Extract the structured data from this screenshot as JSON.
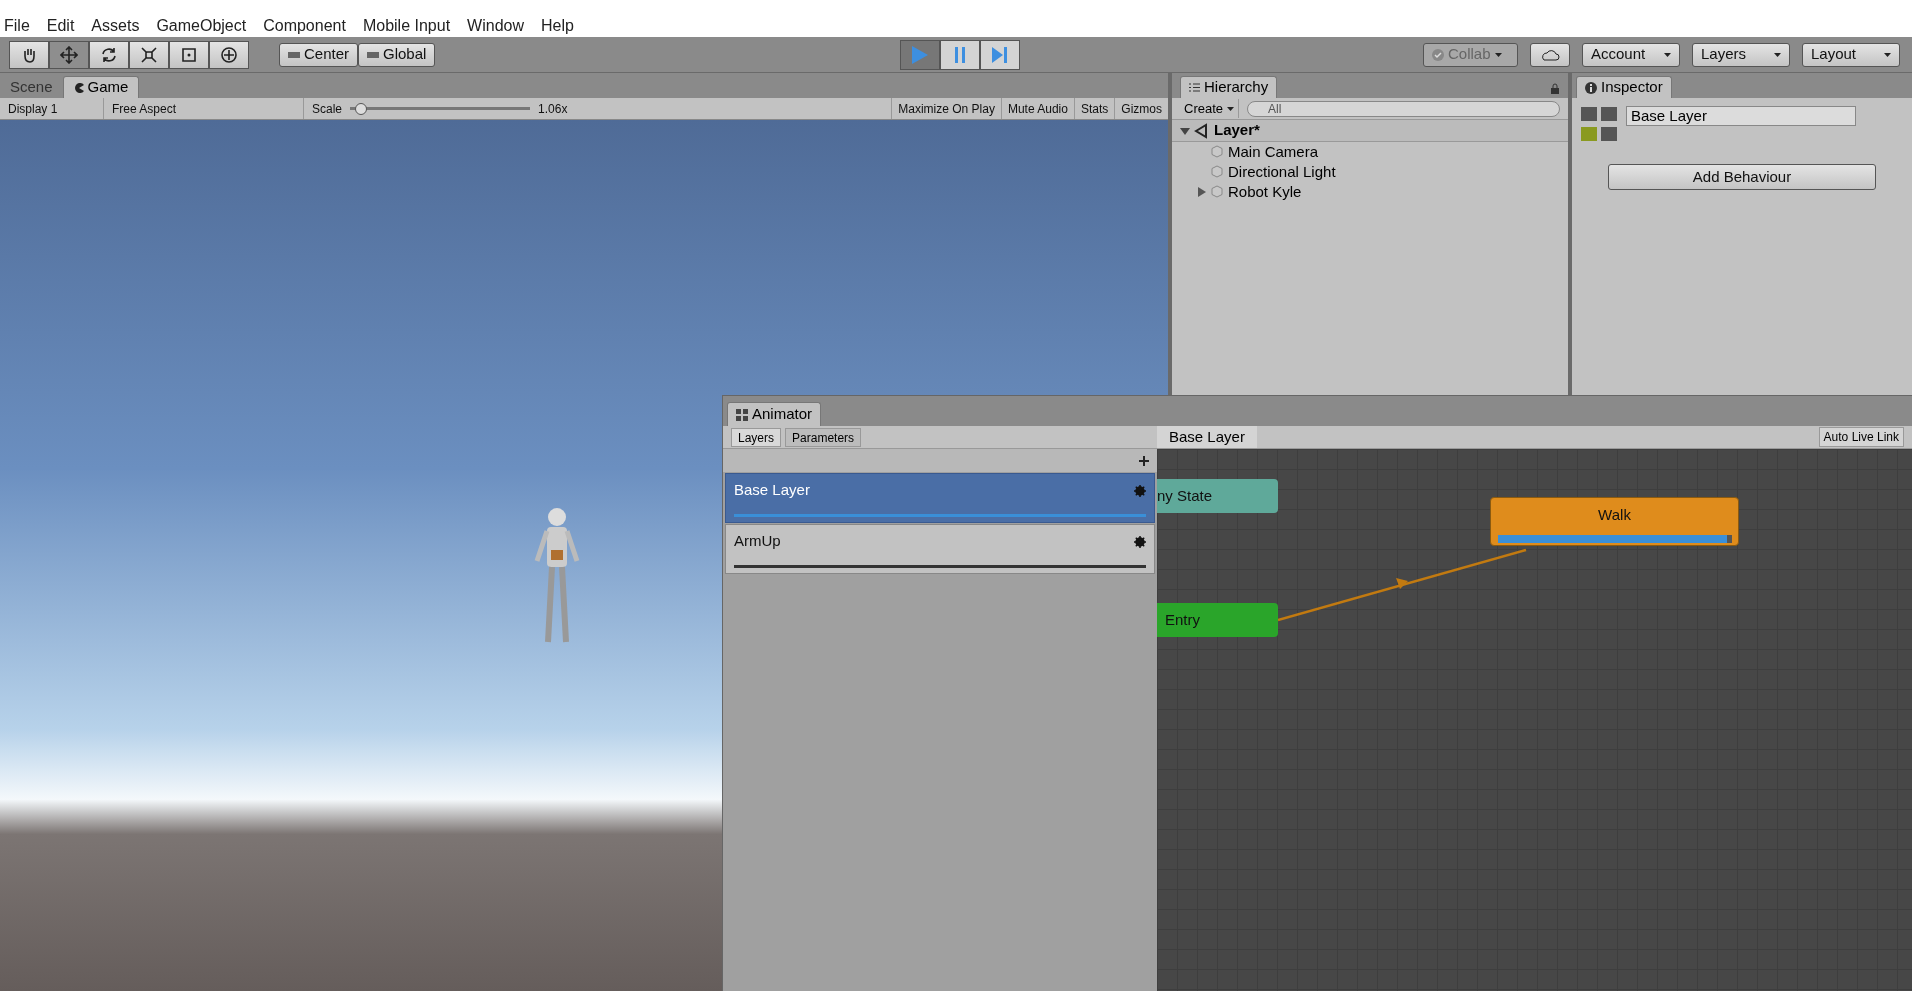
{
  "menu": [
    "File",
    "Edit",
    "Assets",
    "GameObject",
    "Component",
    "Mobile Input",
    "Window",
    "Help"
  ],
  "tools": [
    {
      "kind": "hand",
      "selected": false
    },
    {
      "kind": "move",
      "selected": true
    },
    {
      "kind": "rotate",
      "selected": false
    },
    {
      "kind": "scale",
      "selected": false
    },
    {
      "kind": "rect",
      "selected": false
    },
    {
      "kind": "transform",
      "selected": false
    }
  ],
  "pivot_buttons": [
    "Center",
    "Global"
  ],
  "playback": {
    "playing": true,
    "paused": false
  },
  "right_toolbar": {
    "collab": "Collab",
    "account": "Account",
    "layers": "Layers",
    "layout": "Layout"
  },
  "view_tabs": [
    {
      "label": "Scene",
      "selected": false
    },
    {
      "label": "Game",
      "selected": true
    }
  ],
  "game_toolbar": {
    "display": "Display 1",
    "aspect": "Free Aspect",
    "scale_label": "Scale",
    "scale": {
      "level": 0.03
    },
    "scale_reading": "1.06x",
    "buttons": [
      "Maximize On Play",
      "Mute Audio",
      "Stats",
      "Gizmos"
    ]
  },
  "hierarchy": {
    "title": "Hierarchy",
    "create": "Create",
    "search_placeholder": "All",
    "scene": {
      "name": "Layer*",
      "expanded": true
    },
    "items": [
      {
        "name": "Main Camera",
        "has_children": false
      },
      {
        "name": "Directional Light",
        "has_children": false
      },
      {
        "name": "Robot Kyle",
        "has_children": true
      }
    ]
  },
  "inspector": {
    "title": "Inspector",
    "name": "Base Layer",
    "button": "Add Behaviour"
  },
  "animator": {
    "title": "Animator",
    "tabs": [
      {
        "label": "Layers",
        "selected": true
      },
      {
        "label": "Parameters",
        "selected": false
      }
    ],
    "breadcrumb": "Base Layer",
    "auto_live_link": "Auto Live Link",
    "layers": [
      {
        "name": "Base Layer",
        "selected": true,
        "level": 1
      },
      {
        "name": "ArmUp",
        "selected": false,
        "level": 1
      }
    ],
    "states": [
      {
        "name": "ny State",
        "kind": "any"
      },
      {
        "name": "Entry",
        "kind": "entry"
      },
      {
        "name": "Walk",
        "kind": "default",
        "level": 0.98
      }
    ]
  }
}
